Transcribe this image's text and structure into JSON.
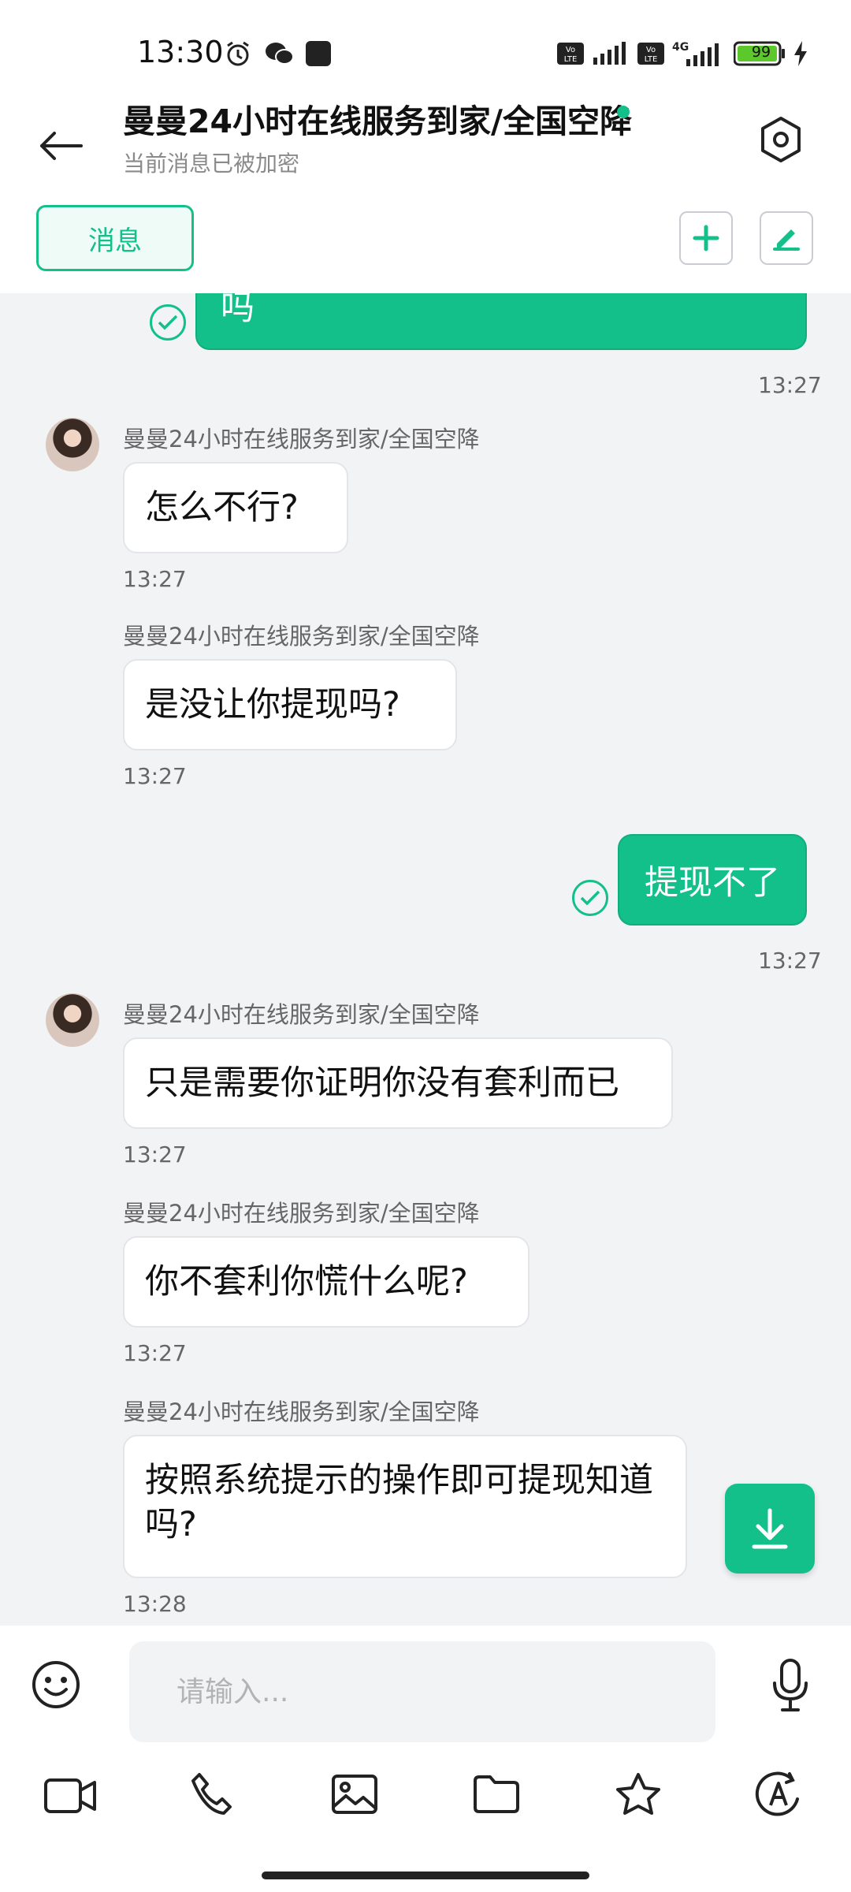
{
  "status_bar": {
    "time": "13:30",
    "battery": "99",
    "network": "4G",
    "icons": [
      "alarm-icon",
      "wechat-icon",
      "app-icon",
      "volte-icon",
      "signal-icon",
      "volte-icon",
      "signal-4g-icon",
      "battery-icon",
      "charging-icon"
    ]
  },
  "header": {
    "title": "曼曼24小时在线服务到家/全国空降",
    "subtitle": "当前消息已被加密",
    "tab_label": "消息",
    "online_color": "#14c08a"
  },
  "chat": {
    "top_partial_message": "吗",
    "top_partial_time": "13:27",
    "messages": [
      {
        "sender": "曼曼24小时在线服务到家/全国空降",
        "text": "怎么不行?",
        "time": "13:27"
      },
      {
        "sender": "曼曼24小时在线服务到家/全国空降",
        "text": "是没让你提现吗?",
        "time": "13:27"
      },
      {
        "sender": "me",
        "text": "提现不了",
        "time": "13:27"
      },
      {
        "sender": "曼曼24小时在线服务到家/全国空降",
        "text": "只是需要你证明你没有套利而已",
        "time": "13:27"
      },
      {
        "sender": "曼曼24小时在线服务到家/全国空降",
        "text": "你不套利你慌什么呢?",
        "time": "13:27"
      },
      {
        "sender": "曼曼24小时在线服务到家/全国空降",
        "text": "按照系统提示的操作即可提现知道吗?",
        "time": "13:28"
      }
    ]
  },
  "input": {
    "placeholder": "请输入..."
  },
  "colors": {
    "accent": "#14c08a",
    "background": "#f2f3f5"
  }
}
